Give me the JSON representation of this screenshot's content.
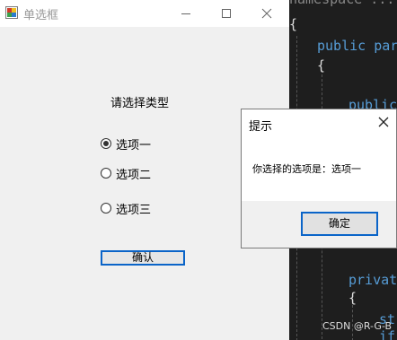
{
  "window": {
    "title": "单选框",
    "prompt": "请选择类型",
    "options": [
      {
        "label": "选项一",
        "checked": true
      },
      {
        "label": "选项二",
        "checked": false
      },
      {
        "label": "选项三",
        "checked": false
      }
    ],
    "confirm_label": "确认"
  },
  "dialog": {
    "title": "提示",
    "message": "你选择的选项是：选项一",
    "ok_label": "确定"
  },
  "editor": {
    "lines": [
      "{",
      "public par",
      "{",
      "public",
      "private",
      "{",
      "str",
      "if"
    ]
  },
  "watermark": "CSDN @R-G-B",
  "colors": {
    "accent": "#0a64c8",
    "editor_bg": "#1e1e1e",
    "keyword": "#569cd6"
  }
}
